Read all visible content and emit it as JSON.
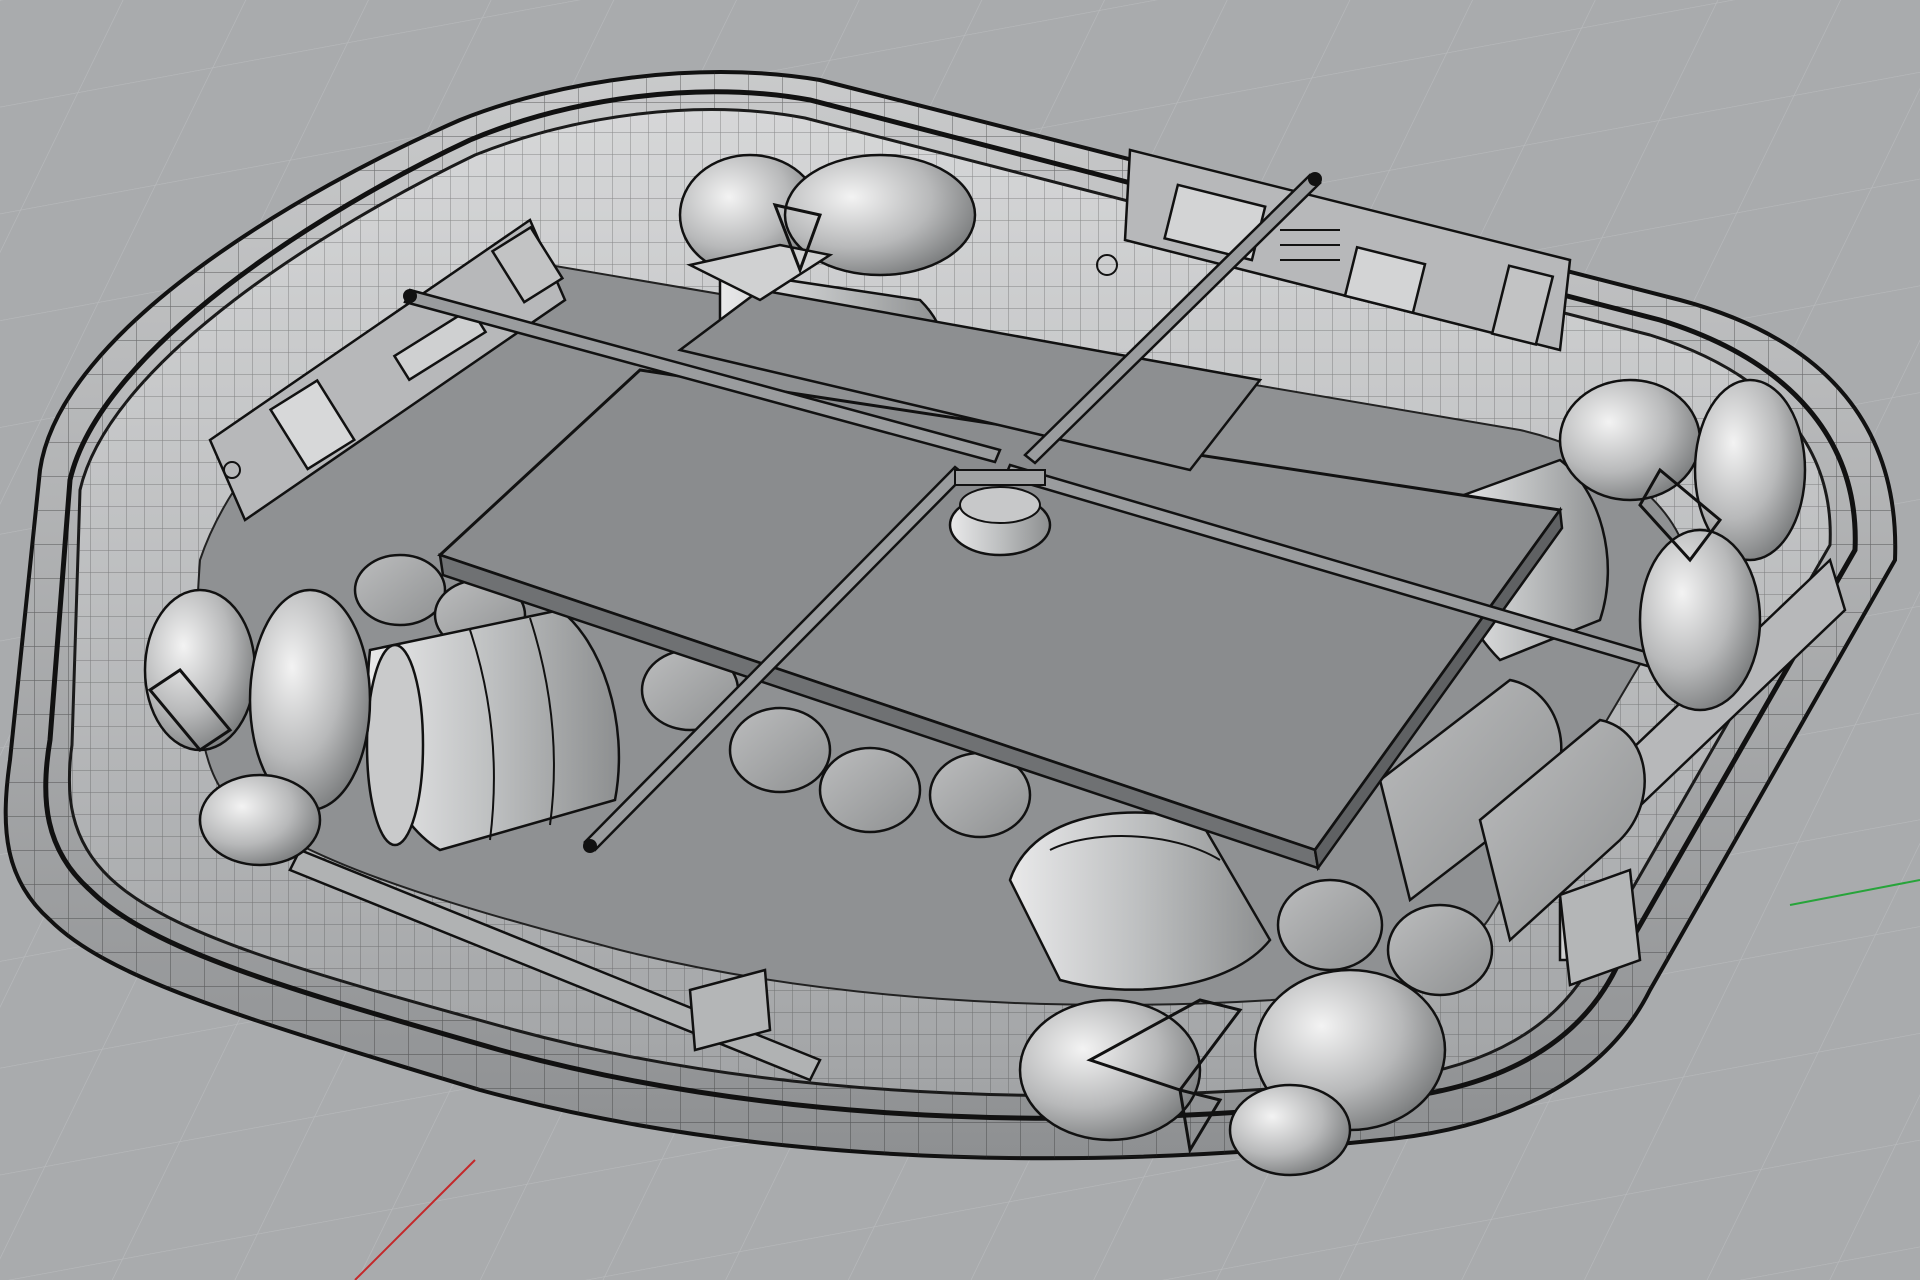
{
  "viewport": {
    "kind": "perspective-shaded",
    "background_color": "#a9abad",
    "grid_color": "#b9bbbd",
    "x_axis_color": "#c4282a",
    "y_axis_color": "#27a43a"
  },
  "model": {
    "description_icons": [
      "robot-chassis",
      "omni-wheel",
      "drive-motor",
      "battery-cell",
      "pcb-board",
      "cross-brace"
    ],
    "omni_wheel_count": 4,
    "drive_motor_count": 4,
    "cross_brace_count": 1,
    "pcb_count": 4
  }
}
